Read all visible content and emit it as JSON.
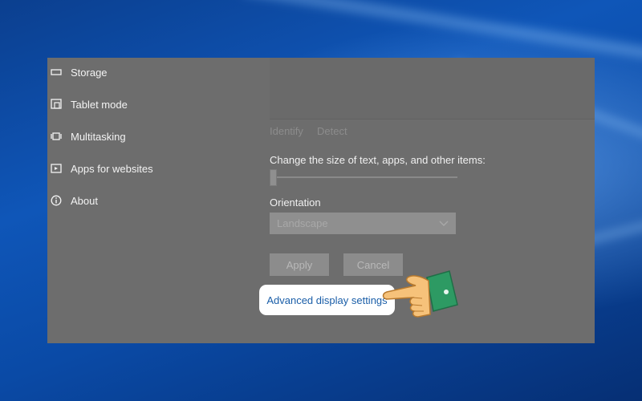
{
  "sidebar": {
    "items": [
      {
        "label": "Storage",
        "icon": "storage-icon"
      },
      {
        "label": "Tablet mode",
        "icon": "tablet-mode-icon"
      },
      {
        "label": "Multitasking",
        "icon": "multitasking-icon"
      },
      {
        "label": "Apps for websites",
        "icon": "apps-for-websites-icon"
      },
      {
        "label": "About",
        "icon": "info-icon"
      }
    ]
  },
  "display": {
    "identify_label": "Identify",
    "detect_label": "Detect",
    "scale_label": "Change the size of text, apps, and other items:",
    "scale_level": 0.0,
    "orientation_label": "Orientation",
    "orientation_value": "Landscape",
    "apply_label": "Apply",
    "cancel_label": "Cancel",
    "advanced_link": "Advanced display settings"
  },
  "colors": {
    "overlay": "#6d6d6d",
    "link": "#1a5ea8",
    "desktop": "#0f56b8",
    "hand_cuff": "#2d9a63",
    "hand_skin": "#f6c27a"
  }
}
